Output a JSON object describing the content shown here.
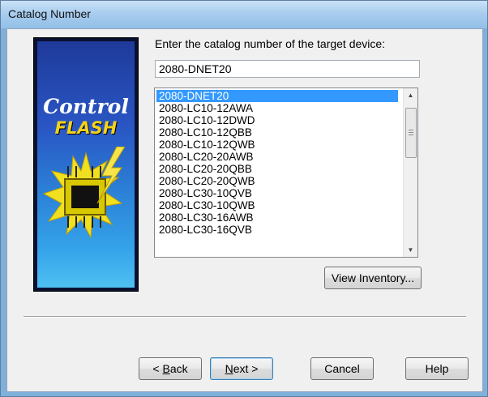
{
  "window": {
    "title": "Catalog Number"
  },
  "logo": {
    "line1": "Control",
    "line2": "FLASH"
  },
  "prompt": "Enter the catalog number of the target device:",
  "catalog_input": {
    "value": "2080-DNET20"
  },
  "catalog_list": {
    "items": [
      "2080-DNET20",
      "2080-LC10-12AWA",
      "2080-LC10-12DWD",
      "2080-LC10-12QBB",
      "2080-LC10-12QWB",
      "2080-LC20-20AWB",
      "2080-LC20-20QBB",
      "2080-LC20-20QWB",
      "2080-LC30-10QVB",
      "2080-LC30-10QWB",
      "2080-LC30-16AWB",
      "2080-LC30-16QVB"
    ],
    "selected_index": 0
  },
  "buttons": {
    "view_inventory": "View Inventory...",
    "back": {
      "accel": "B",
      "rest": "ack",
      "prefix": "< "
    },
    "next": {
      "accel": "N",
      "rest": "ext >"
    },
    "cancel": "Cancel",
    "help": "Help"
  },
  "colors": {
    "selection": "#3399ff",
    "title_bar": "#a9cdee",
    "flash_yellow": "#f3d21a"
  },
  "icons": {
    "scroll_up": "triangle-up",
    "scroll_down": "triangle-down"
  }
}
